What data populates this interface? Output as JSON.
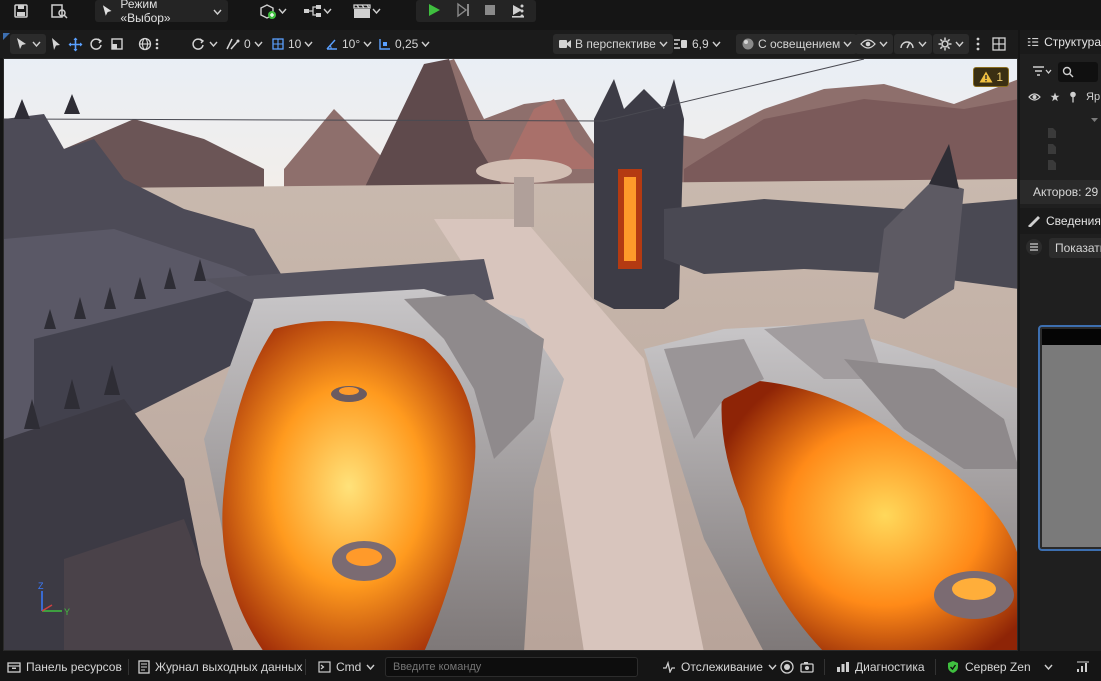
{
  "toolbar": {
    "mode_label": "Режим «Выбор»"
  },
  "viewport_toolbar": {
    "rotation_snap_count": "0",
    "grid_snap": "10",
    "angle_snap": "10°",
    "scale_snap": "0,25",
    "view_mode": "В перспективе",
    "camera_speed": "6,9",
    "lighting_mode": "С освещением"
  },
  "viewport": {
    "warning_count": "1"
  },
  "right_panel": {
    "outliner_tab": "Структура",
    "actors_count": "Акторов: 29",
    "details_tab": "Сведения",
    "show_button": "Показать",
    "filter_col_label": "Яр"
  },
  "status_bar": {
    "content_drawer": "Панель ресурсов",
    "output_log": "Журнал выходных данных",
    "cmd_label": "Cmd",
    "cmd_placeholder": "Введите команду",
    "trace": "Отслеживание",
    "diagnostics": "Диагностика",
    "zen_server": "Сервер Zen"
  },
  "colors": {
    "accent_blue": "#3d6fb0",
    "play_green": "#3fbf3f",
    "warning_yellow": "#f0c040"
  }
}
